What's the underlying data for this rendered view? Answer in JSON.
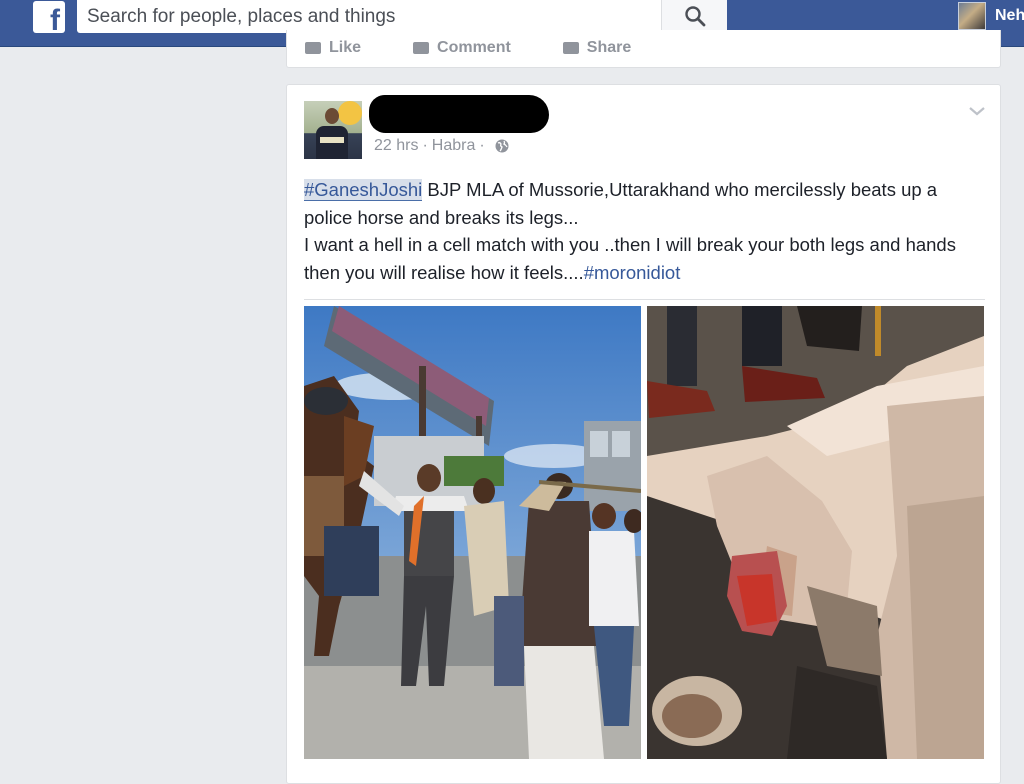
{
  "header": {
    "logo_letter": "f",
    "search_placeholder": "Search for people, places and things",
    "profile_name": "Neh"
  },
  "previous_post": {
    "actions": [
      "Like",
      "Comment",
      "Share"
    ]
  },
  "post": {
    "time": "22 hrs",
    "separator": "·",
    "location": "Habra",
    "hashtag_1": "#GaneshJoshi",
    "text_1": " BJP MLA of Mussorie,Uttarakhand who mercilessly beats up a police horse and breaks its legs...",
    "text_2": "I want a hell in a cell match with you ..then I will break your both legs and hands then you will realise how it feels....",
    "hashtag_2": "#moronidiot"
  },
  "colors": {
    "header_blue": "#3b5998",
    "link_blue": "#365899",
    "page_bg": "#e9ebee"
  },
  "icons": {
    "logo": "facebook-logo",
    "search": "search-icon",
    "privacy": "globe-icon",
    "options": "chevron-down-icon"
  }
}
